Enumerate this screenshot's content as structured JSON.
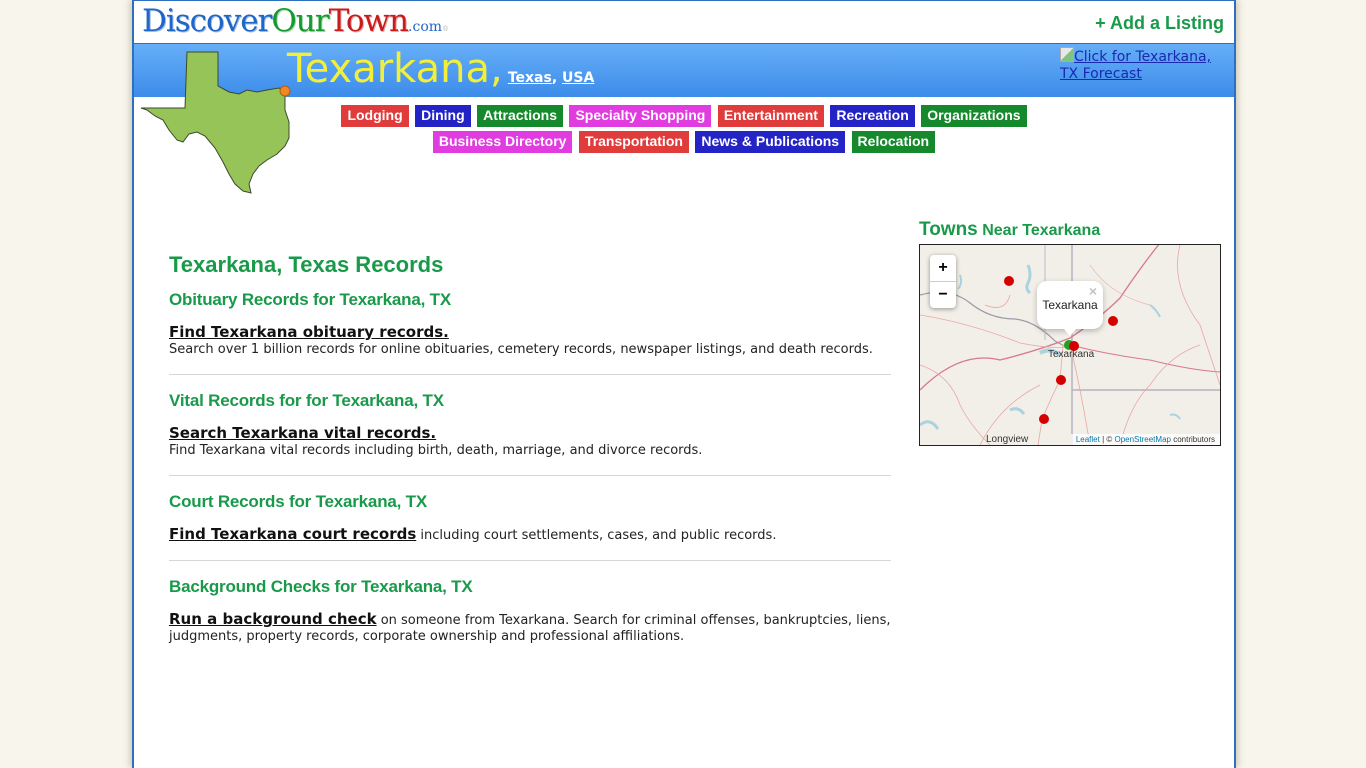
{
  "header": {
    "logo": {
      "part1": "Discover",
      "part2": "Our",
      "part3": "Town",
      "part4": ".com",
      "part5": "®"
    },
    "add_listing": "+ Add a Listing"
  },
  "banner": {
    "city": "Texarkana",
    "comma": ",",
    "state_link": "Texas",
    "country_link": "USA",
    "forecast_link": "Click for Texarkana, TX Forecast"
  },
  "nav": {
    "row1": [
      {
        "label": "Lodging",
        "color": "#e03c3c"
      },
      {
        "label": "Dining",
        "color": "#2323c6"
      },
      {
        "label": "Attractions",
        "color": "#15892b"
      },
      {
        "label": "Specialty Shopping",
        "color": "#e03ce0"
      },
      {
        "label": "Entertainment",
        "color": "#e03c3c"
      },
      {
        "label": "Recreation",
        "color": "#2323c6"
      },
      {
        "label": "Organizations",
        "color": "#15892b"
      }
    ],
    "row2": [
      {
        "label": "Business Directory",
        "color": "#e03ce0"
      },
      {
        "label": "Transportation",
        "color": "#e03c3c"
      },
      {
        "label": "News & Publications",
        "color": "#2323c6"
      },
      {
        "label": "Relocation",
        "color": "#15892b"
      }
    ]
  },
  "main": {
    "title": "Texarkana, Texas Records",
    "sections": [
      {
        "heading": "Obituary Records for Texarkana, TX",
        "link": "Find Texarkana obituary records.",
        "text": "Search over 1 billion records for online obituaries, cemetery records, newspaper listings, and death records.",
        "inline": false
      },
      {
        "heading": "Vital Records for for Texarkana, TX",
        "link": "Search Texarkana vital records.",
        "text": "Find Texarkana vital records including birth, death, marriage, and divorce records.",
        "inline": false
      },
      {
        "heading": "Court Records for Texarkana, TX",
        "link": "Find Texarkana court records",
        "text": " including court settlements, cases, and public records.",
        "inline": true
      },
      {
        "heading": "Background Checks for Texarkana, TX",
        "link": "Run a background check",
        "text": " on someone from Texarkana. Search for criminal offenses, bankruptcies, liens, judgments, property records, corporate ownership and professional affiliations.",
        "inline": true
      }
    ]
  },
  "sidebar": {
    "title_big": "Towns",
    "title_small": " Near Texarkana",
    "map": {
      "zoom_in": "+",
      "zoom_out": "−",
      "popup_text": "Texarkana",
      "popup_close": "×",
      "city_label": "Texarkana",
      "longview_label": "Longview",
      "attribution_leaflet": "Leaflet",
      "attribution_sep": " | © ",
      "attribution_osm": "OpenStreetMap",
      "attribution_tail": " contributors",
      "markers": [
        "town-1",
        "town-2",
        "town-3",
        "town-4",
        "texarkana-ar"
      ],
      "current_town_color": "#22a020",
      "marker_color": "#d40000"
    }
  }
}
